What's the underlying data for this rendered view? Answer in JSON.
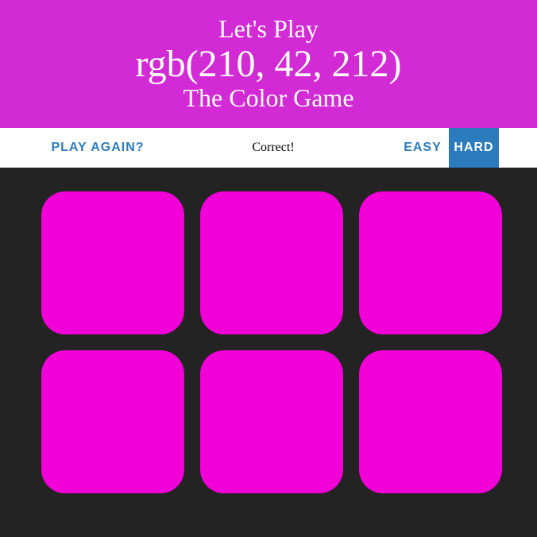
{
  "header": {
    "line1": "Let's Play",
    "target_color": "rgb(210, 42, 212)",
    "line3": "The Color Game",
    "background": "#d22ad4"
  },
  "stripe": {
    "reset_label": "PLAY AGAIN?",
    "message": "Correct!",
    "easy_label": "EASY",
    "hard_label": "HARD",
    "selected_mode": "HARD",
    "accent_color": "#2c7bbd"
  },
  "squares": [
    {
      "color": "#f200d8"
    },
    {
      "color": "#f200d8"
    },
    {
      "color": "#f200d8"
    },
    {
      "color": "#f200d8"
    },
    {
      "color": "#f200d8"
    },
    {
      "color": "#f200d8"
    }
  ],
  "background_color": "#232323"
}
